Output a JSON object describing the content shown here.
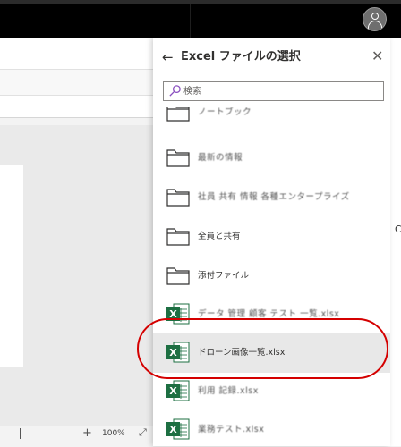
{
  "statusbar": {
    "zoom": "100%",
    "plus": "+",
    "expand": "⤢"
  },
  "right_text": "C",
  "panel": {
    "title": "Excel ファイルの選択",
    "back_icon": "arrow-left-icon",
    "close_icon": "close-icon",
    "search": {
      "placeholder": "検索",
      "value": ""
    }
  },
  "files": [
    {
      "label": "ノートブック",
      "type": "folder",
      "obscured": true
    },
    {
      "label": "最新の情報",
      "type": "folder",
      "obscured": true
    },
    {
      "label": "社員 共有 情報 各種エンタープライズ",
      "type": "folder",
      "obscured": true
    },
    {
      "label": "全員と共有",
      "type": "folder",
      "obscured": false
    },
    {
      "label": "添付ファイル",
      "type": "folder",
      "obscured": false
    },
    {
      "label": "データ 管理 顧客 テスト 一覧.xlsx",
      "type": "excel",
      "obscured": true
    },
    {
      "label": "ドローン画像一覧.xlsx",
      "type": "excel",
      "obscured": false,
      "selected": true
    },
    {
      "label": "利用 記録.xlsx",
      "type": "excel",
      "obscured": true
    },
    {
      "label": "業務テスト.xlsx",
      "type": "excel",
      "obscured": true
    }
  ],
  "colors": {
    "excel_green": "#1d6f42",
    "annotation": "#d40000",
    "selected_bg": "#e8e8e8",
    "search_icon": "#8a4fbf"
  }
}
